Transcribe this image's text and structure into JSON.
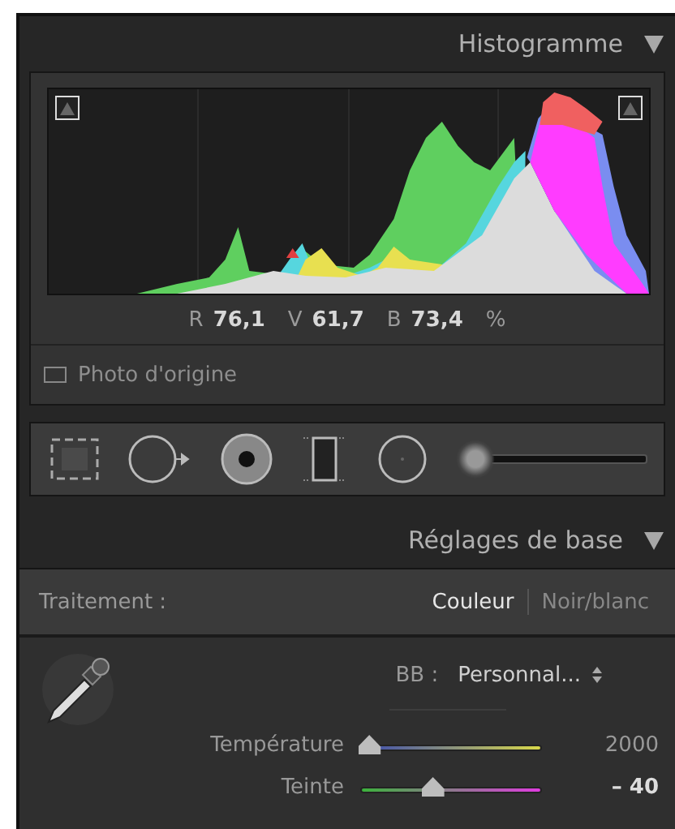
{
  "histogram_panel": {
    "title": "Histogramme",
    "expanded": true,
    "readout": [
      {
        "label": "R",
        "value": "76,1"
      },
      {
        "label": "V",
        "value": "61,7"
      },
      {
        "label": "B",
        "value": "73,4"
      }
    ],
    "unit": "%",
    "original_photo": {
      "label": "Photo d'origine",
      "checked": false
    }
  },
  "tools": [
    {
      "kind": "crop"
    },
    {
      "kind": "spot"
    },
    {
      "kind": "redeye"
    },
    {
      "kind": "graduated"
    },
    {
      "kind": "radial"
    },
    {
      "kind": "brush",
      "level": 0.05
    }
  ],
  "basic_panel": {
    "title": "Réglages de base",
    "expanded": true,
    "treatment": {
      "label": "Traitement :",
      "options": [
        {
          "label": "Couleur",
          "selected": true
        },
        {
          "label": "Noir/blanc",
          "selected": false
        }
      ]
    },
    "white_balance": {
      "label": "BB :",
      "value": "Personnal..."
    },
    "sliders": [
      {
        "kind": "temperature",
        "label": "Température",
        "level": 0.05,
        "reading": "2000"
      },
      {
        "kind": "tint",
        "label": "Teinte",
        "level": 0.4,
        "reading": "– 40"
      }
    ]
  }
}
